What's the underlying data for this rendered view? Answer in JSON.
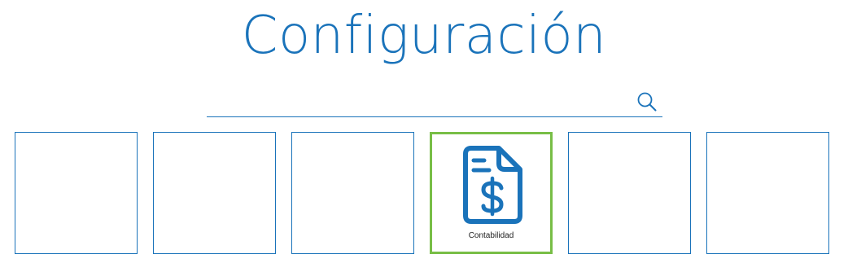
{
  "page": {
    "title": "Configuración"
  },
  "search": {
    "value": "",
    "placeholder": "",
    "icon": "search-icon"
  },
  "tiles": [
    {
      "label": "",
      "icon": "",
      "selected": false
    },
    {
      "label": "",
      "icon": "",
      "selected": false
    },
    {
      "label": "",
      "icon": "",
      "selected": false
    },
    {
      "label": "Contabilidad",
      "icon": "invoice-dollar-icon",
      "selected": true
    },
    {
      "label": "",
      "icon": "",
      "selected": false
    },
    {
      "label": "",
      "icon": "",
      "selected": false
    }
  ],
  "colors": {
    "accent": "#1a73ba",
    "selected_border": "#78be46"
  }
}
